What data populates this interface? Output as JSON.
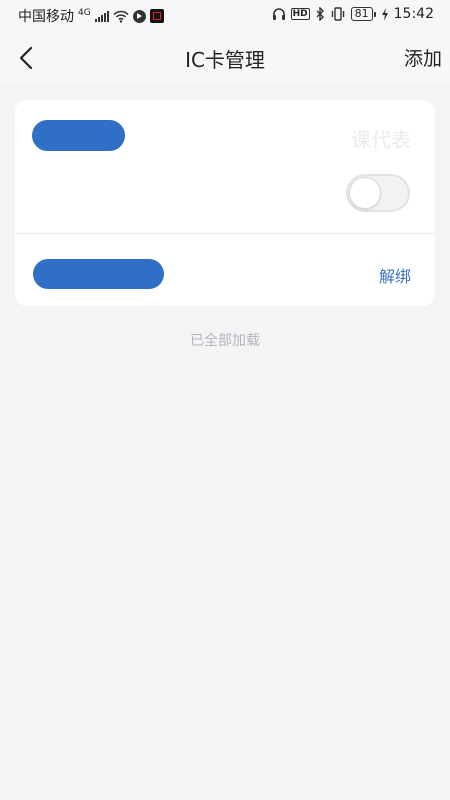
{
  "status_bar": {
    "carrier": "中国移动",
    "network": "4G",
    "hd": "HD",
    "battery": "81",
    "time": "15:42"
  },
  "nav": {
    "title": "IC卡管理",
    "add_label": "添加"
  },
  "card": {
    "card_name": "",
    "schedule_label": "课代表",
    "toggle_on": false,
    "card_number": "",
    "unbind_label": "解绑"
  },
  "footer": {
    "text": "已全部加载"
  },
  "colors": {
    "accent": "#3a72c4",
    "redaction": "#2f6fc6",
    "background": "#f3f4f6"
  }
}
